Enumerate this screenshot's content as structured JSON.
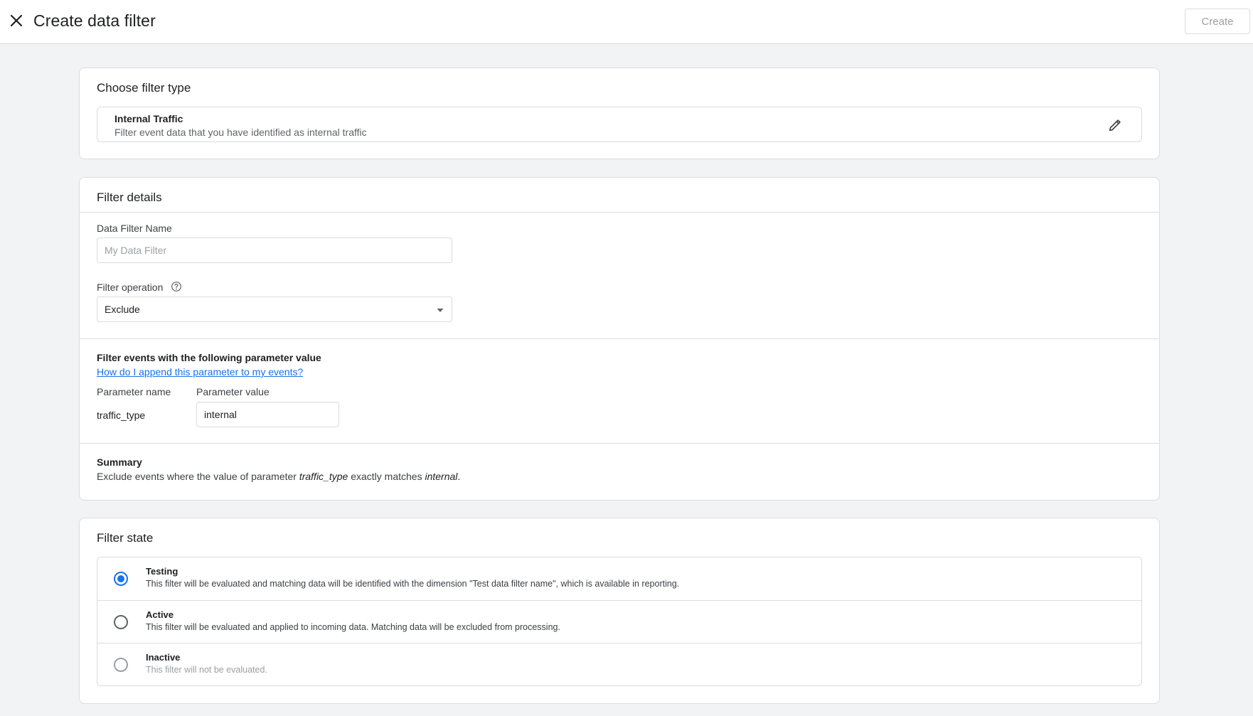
{
  "header": {
    "title": "Create data filter",
    "create_label": "Create"
  },
  "filter_type": {
    "title": "Choose filter type",
    "type_name": "Internal Traffic",
    "type_description": "Filter event data that you have identified as internal traffic"
  },
  "filter_details": {
    "title": "Filter details",
    "name_label": "Data Filter Name",
    "name_placeholder": "My Data Filter",
    "name_value": "",
    "operation_label": "Filter operation",
    "operation_value": "Exclude",
    "params_heading": "Filter events with the following parameter value",
    "help_link": "How do I append this parameter to my events?",
    "param_name_header": "Parameter name",
    "param_value_header": "Parameter value",
    "param_name": "traffic_type",
    "param_value": "internal",
    "summary_heading": "Summary",
    "summary_prefix": "Exclude events where the value of parameter ",
    "summary_param": "traffic_type",
    "summary_middle": " exactly matches ",
    "summary_value": "internal",
    "summary_suffix": "."
  },
  "filter_state": {
    "title": "Filter state",
    "options": [
      {
        "name": "Testing",
        "description": "This filter will be evaluated and matching data will be identified with the dimension \"Test data filter name\", which is available in reporting.",
        "selected": true
      },
      {
        "name": "Active",
        "description": "This filter will be evaluated and applied to incoming data. Matching data will be excluded from processing.",
        "selected": false
      },
      {
        "name": "Inactive",
        "description": "This filter will not be evaluated.",
        "selected": false
      }
    ]
  },
  "colors": {
    "accent": "#1a73e8",
    "border": "#dadce0",
    "background": "#f1f3f4"
  },
  "icons": [
    "close-icon",
    "pencil-icon",
    "help-circle-icon",
    "caret-down-icon"
  ]
}
